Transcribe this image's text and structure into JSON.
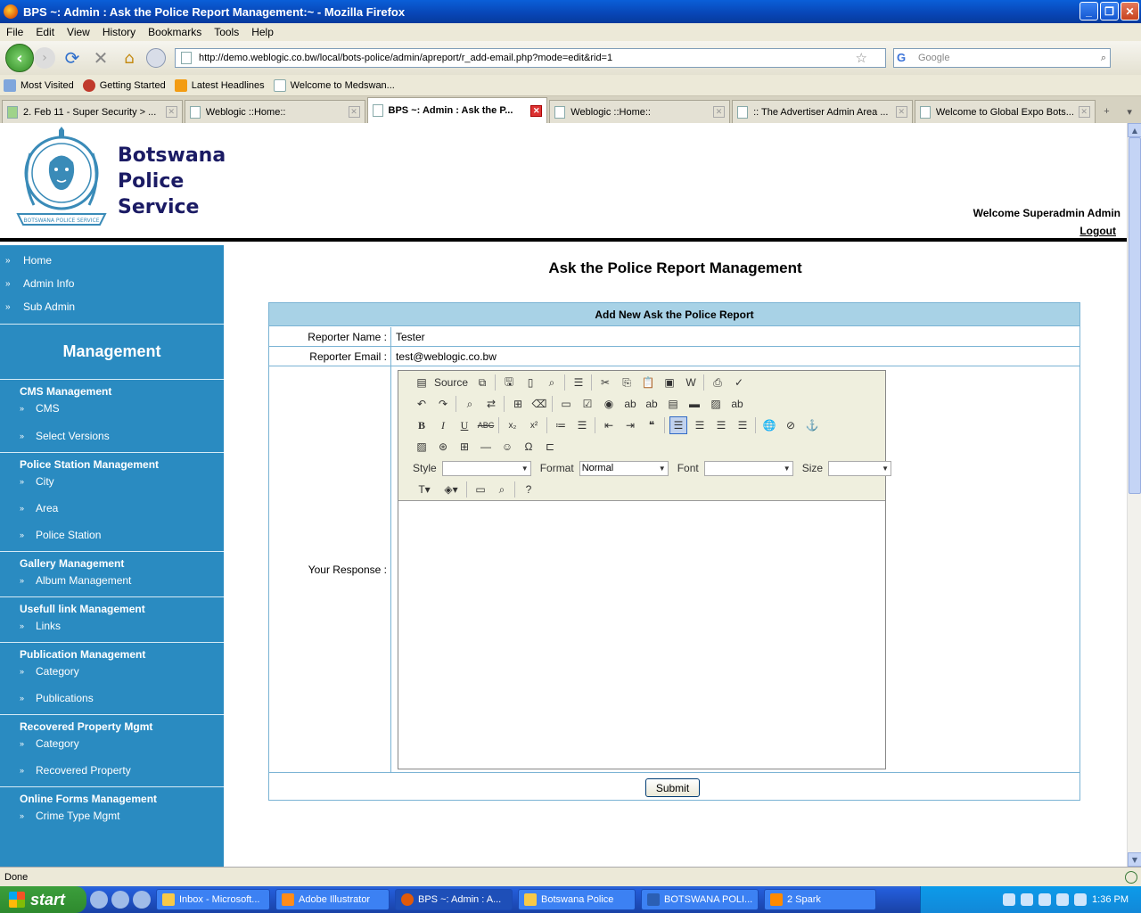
{
  "window": {
    "title": "BPS ~: Admin : Ask the Police Report Management:~ - Mozilla Firefox"
  },
  "menu": [
    "File",
    "Edit",
    "View",
    "History",
    "Bookmarks",
    "Tools",
    "Help"
  ],
  "nav": {
    "url": "http://demo.weblogic.co.bw/local/bots-police/admin/apreport/r_add-email.php?mode=edit&rid=1",
    "search_placeholder": "Google"
  },
  "bookmarks": [
    "Most Visited",
    "Getting Started",
    "Latest Headlines",
    "Welcome to Medswan..."
  ],
  "tabs": [
    {
      "label": "2. Feb 11 - Super Security > ..."
    },
    {
      "label": "Weblogic ::Home::"
    },
    {
      "label": "BPS ~: Admin : Ask the P..."
    },
    {
      "label": "Weblogic ::Home::"
    },
    {
      "label": ":: The Advertiser Admin Area ..."
    },
    {
      "label": "Welcome to Global Expo Bots..."
    }
  ],
  "header": {
    "brand_line1": "Botswana",
    "brand_line2": "Police",
    "brand_line3": "Service",
    "logo_ring_text": "BOTSWANA POLICE SERVICE",
    "welcome": "Welcome Superadmin Admin",
    "logout": "Logout"
  },
  "sidebar": {
    "top_items": [
      "Home",
      "Admin Info",
      "Sub Admin"
    ],
    "heading": "Management",
    "groups": [
      {
        "title": "CMS Management",
        "items": [
          "CMS",
          "Select Versions"
        ]
      },
      {
        "title": "Police Station Management",
        "items": [
          "City",
          "Area",
          "Police Station"
        ]
      },
      {
        "title": "Gallery Management",
        "items": [
          "Album Management"
        ]
      },
      {
        "title": "Usefull link Management",
        "items": [
          "Links"
        ]
      },
      {
        "title": "Publication Management",
        "items": [
          "Category",
          "Publications"
        ]
      },
      {
        "title": "Recovered Property Mgmt",
        "items": [
          "Category",
          "Recovered Property"
        ]
      },
      {
        "title": "Online Forms Management",
        "items": [
          "Crime Type Mgmt"
        ]
      }
    ]
  },
  "main": {
    "title": "Ask the Police Report Management",
    "form_header": "Add New Ask the Police Report",
    "reporter_name_label": "Reporter Name :",
    "reporter_name": "Tester",
    "reporter_email_label": "Reporter Email :",
    "reporter_email": "test@weblogic.co.bw",
    "response_label": "Your Response :",
    "submit": "Submit"
  },
  "editor": {
    "source_label": "Source",
    "style_label": "Style",
    "format_label": "Format",
    "format_value": "Normal",
    "font_label": "Font",
    "size_label": "Size"
  },
  "status": "Done",
  "taskbar": {
    "start": "start",
    "tasks": [
      "Inbox - Microsoft...",
      "Adobe Illustrator",
      "BPS ~: Admin : A...",
      "Botswana Police",
      "BOTSWANA POLI...",
      "2 Spark"
    ],
    "clock": "1:36 PM"
  }
}
